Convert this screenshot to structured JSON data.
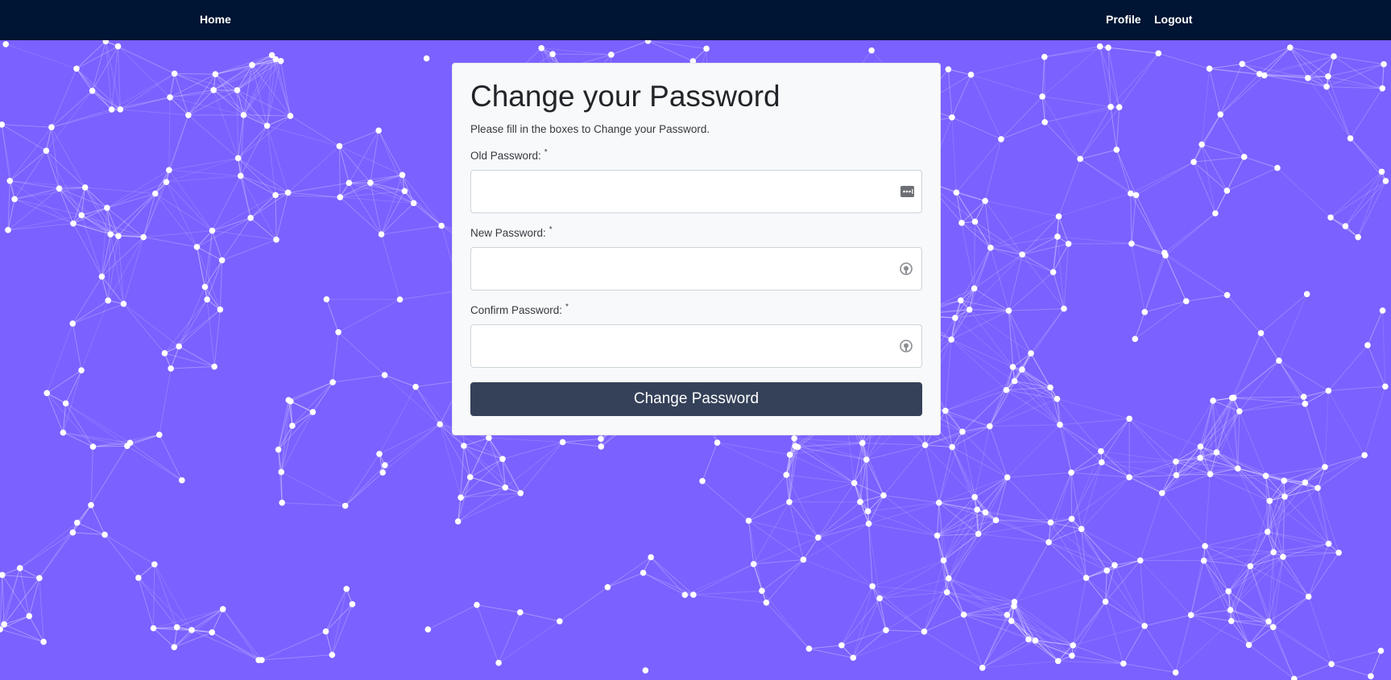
{
  "nav": {
    "home": "Home",
    "profile": "Profile",
    "logout": "Logout"
  },
  "form": {
    "title": "Change your Password",
    "subtitle": "Please fill in the boxes to Change your Password.",
    "fields": [
      {
        "label": "Old Password:",
        "required_mark": "*",
        "value": "",
        "icon": "password-manager-key-icon"
      },
      {
        "label": "New Password:",
        "required_mark": "*",
        "value": "",
        "icon": "password-generator-icon"
      },
      {
        "label": "Confirm Password:",
        "required_mark": "*",
        "value": "",
        "icon": "password-generator-icon"
      }
    ],
    "submit_label": "Change Password"
  },
  "colors": {
    "navbar": "#001433",
    "background": "#7b61ff",
    "card": "#f8f9fa",
    "button": "#344159"
  }
}
